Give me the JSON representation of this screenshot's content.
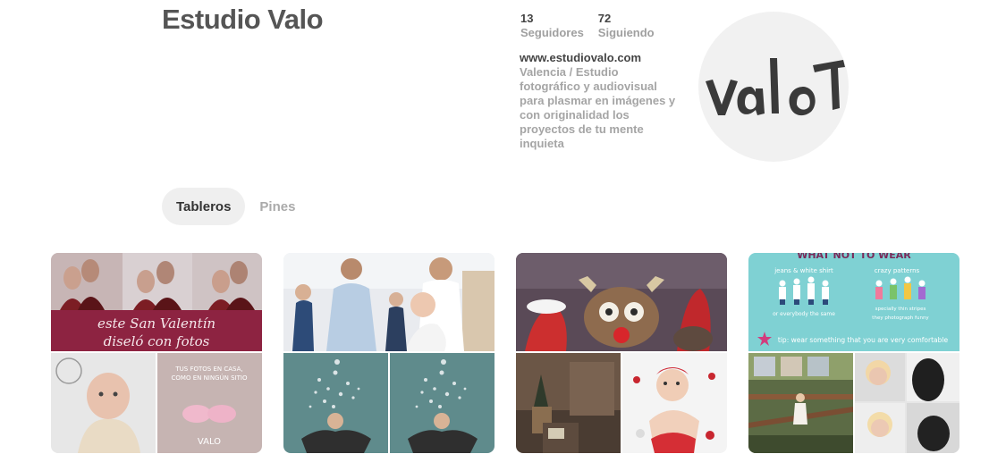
{
  "profile": {
    "name": "Estudio Valo",
    "followers_count": "13",
    "followers_label": "Seguidores",
    "following_count": "72",
    "following_label": "Siguiendo",
    "website": "www.estudiovalo.com",
    "bio": "Valencia / Estudio fotográfico y audiovisual para plasmar en imágenes y con originalidad los proyectos de tu mente inquieta",
    "avatar_text": "valo"
  },
  "tabs": [
    {
      "label": "Tableros",
      "active": true
    },
    {
      "label": "Pines",
      "active": false
    }
  ],
  "boards": [
    {
      "cover_text_line1": "este San Valentín",
      "cover_text_line2": "diseló con fotos",
      "tile_text_1": "TUS FOTOS EN CASA,",
      "tile_text_2": "COMO EN NINGÚN SITIO",
      "tile_logo": "VALO"
    },
    {},
    {},
    {
      "cover_title": "WHAT NOT TO WEAR",
      "cover_col1": "jeans & white shirt",
      "cover_col2": "crazy patterns",
      "cover_note1": "or everybody the same",
      "cover_note2": "they photograph funny",
      "cover_note3": "specially thin stripes",
      "cover_tip": "tip: wear something that you are very comfortable"
    }
  ]
}
